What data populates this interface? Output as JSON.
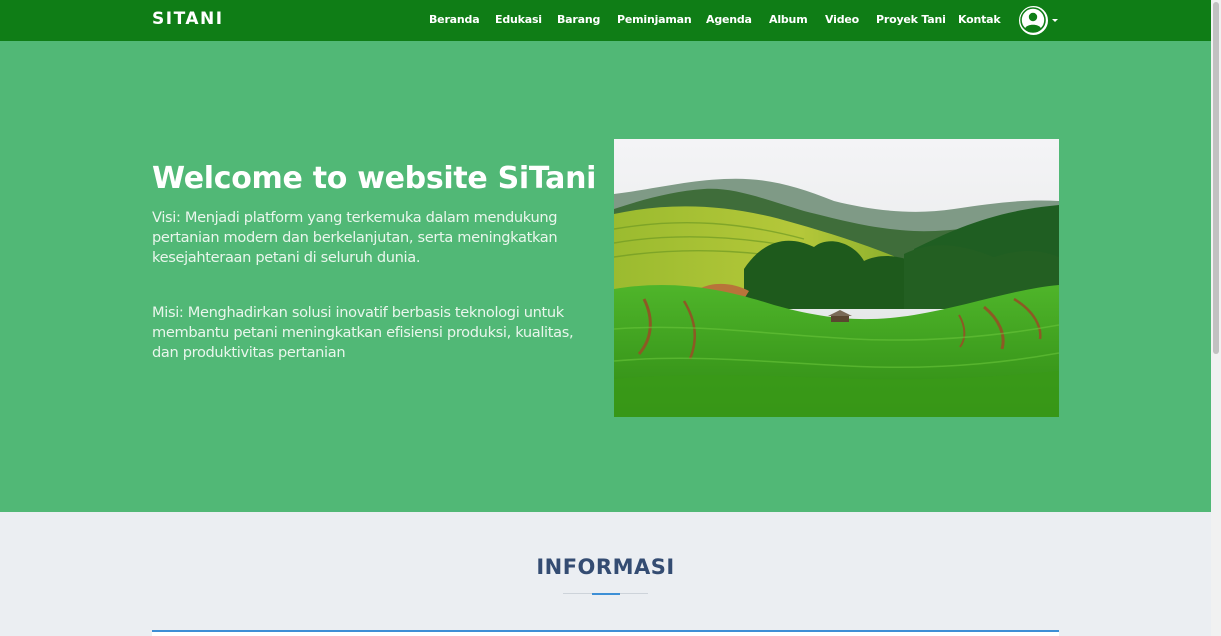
{
  "navbar": {
    "brand": "SITANI",
    "items": [
      {
        "label": "Beranda"
      },
      {
        "label": "Edukasi"
      },
      {
        "label": "Barang"
      },
      {
        "label": "Peminjaman"
      },
      {
        "label": "Agenda"
      },
      {
        "label": "Album"
      },
      {
        "label": "Video"
      },
      {
        "label": "Proyek Tani"
      },
      {
        "label": "Kontak"
      }
    ],
    "user_icon": "user-circle-icon",
    "caret_icon": "caret-down-icon"
  },
  "hero": {
    "title": "Welcome to website SiTani",
    "visi": "Visi: Menjadi platform yang terkemuka dalam mendukung pertanian modern dan berkelanjutan, serta meningkatkan kesejahteraan petani di seluruh dunia.",
    "misi": "Misi: Menghadirkan solusi inovatif berbasis teknologi untuk membantu petani meningkatkan efisiensi produksi, kualitas, dan produktivitas pertanian",
    "image": "rice-terrace-photo"
  },
  "informasi": {
    "title": "INFORMASI"
  },
  "colors": {
    "navbar": "#0f7d16",
    "hero_bg": "#51b876",
    "section_title": "#344c72",
    "accent": "#3d8fd6",
    "section_bg": "#ebeef2"
  }
}
